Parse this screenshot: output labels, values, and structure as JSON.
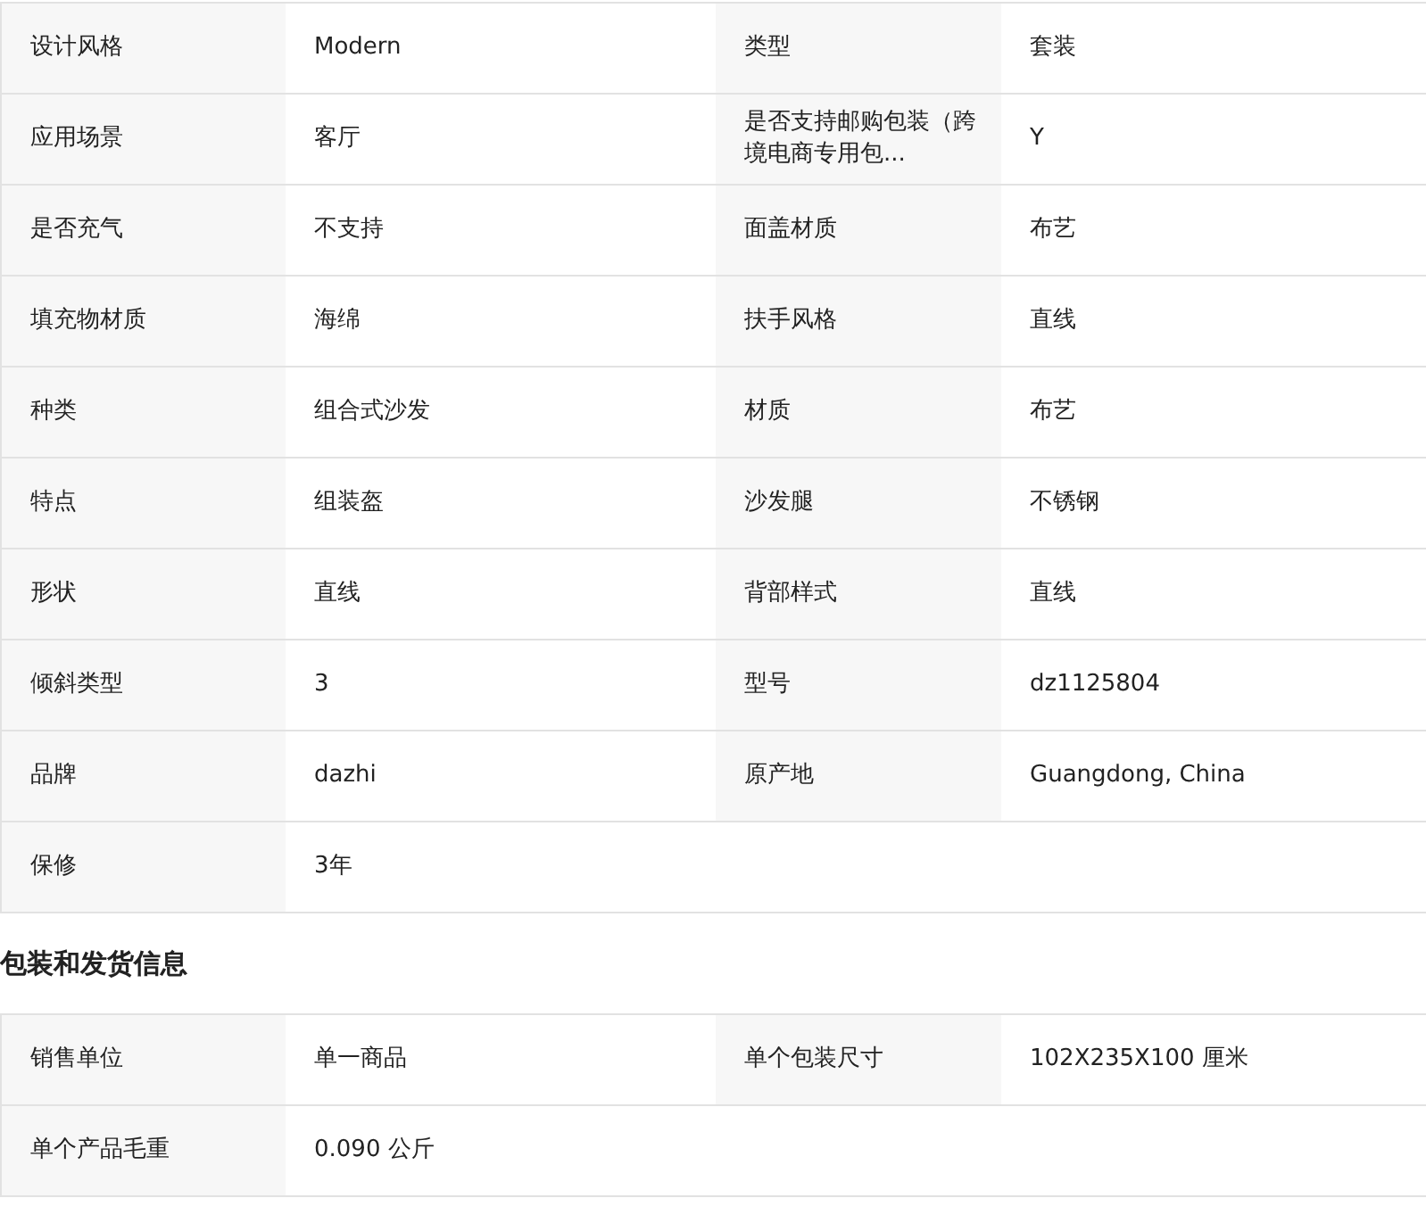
{
  "sections": [
    {
      "rows": [
        [
          {
            "label": "设计风格",
            "value": "Modern"
          },
          {
            "label": "类型",
            "value": "套装"
          }
        ],
        [
          {
            "label": "应用场景",
            "value": "客厅"
          },
          {
            "label": "是否支持邮购包装（跨境电商专用包...",
            "value": "Y"
          }
        ],
        [
          {
            "label": "是否充气",
            "value": "不支持"
          },
          {
            "label": "面盖材质",
            "value": "布艺"
          }
        ],
        [
          {
            "label": "填充物材质",
            "value": "海绵"
          },
          {
            "label": "扶手风格",
            "value": "直线"
          }
        ],
        [
          {
            "label": "种类",
            "value": "组合式沙发"
          },
          {
            "label": "材质",
            "value": "布艺"
          }
        ],
        [
          {
            "label": "特点",
            "value": "组装盔"
          },
          {
            "label": "沙发腿",
            "value": "不锈钢"
          }
        ],
        [
          {
            "label": "形状",
            "value": "直线"
          },
          {
            "label": "背部样式",
            "value": "直线"
          }
        ],
        [
          {
            "label": "倾斜类型",
            "value": "3"
          },
          {
            "label": "型号",
            "value": "dz1125804"
          }
        ],
        [
          {
            "label": "品牌",
            "value": "dazhi"
          },
          {
            "label": "原产地",
            "value": "Guangdong, China"
          }
        ],
        [
          {
            "label": "保修",
            "value": "3年"
          }
        ]
      ]
    },
    {
      "title": "包装和发货信息",
      "rows": [
        [
          {
            "label": "销售单位",
            "value": "单一商品"
          },
          {
            "label": "单个包装尺寸",
            "value": "102X235X100 厘米"
          }
        ],
        [
          {
            "label": "单个产品毛重",
            "value": "0.090 公斤"
          }
        ]
      ]
    }
  ]
}
